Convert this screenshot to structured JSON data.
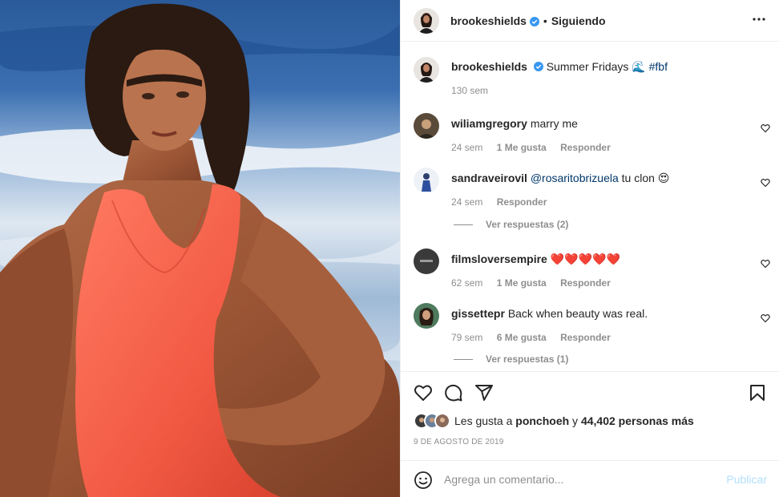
{
  "post": {
    "author": "brookeshields",
    "follow_separator": "•",
    "follow_label": "Siguiendo",
    "caption_text": "Summer Fridays 🌊 ",
    "caption_hashtag": "#fbf",
    "caption_time": "130 sem"
  },
  "comments": [
    {
      "user": "wiliamgregory",
      "text": "marry me",
      "time": "24 sem",
      "likes": "1 Me gusta",
      "reply": "Responder"
    },
    {
      "user": "sandraveirovil",
      "mention": "@rosaritobrizuela",
      "text": " tu clon 😍",
      "time": "24 sem",
      "reply": "Responder",
      "view_replies": "Ver respuestas (2)"
    },
    {
      "user": "filmsloversempire",
      "text": "❤️❤️❤️❤️❤️",
      "time": "62 sem",
      "likes": "1 Me gusta",
      "reply": "Responder"
    },
    {
      "user": "gissettepr",
      "text": "Back when beauty was real.",
      "time": "79 sem",
      "likes": "6 Me gusta",
      "reply": "Responder",
      "view_replies": "Ver respuestas (1)"
    }
  ],
  "likes": {
    "prefix": "Les gusta a ",
    "user": "ponchoeh",
    "conj": " y ",
    "count": "44,402 personas más"
  },
  "date": "9 DE AGOSTO DE 2019",
  "add_comment": {
    "placeholder": "Agrega un comentario...",
    "publish_label": "Publicar"
  },
  "colors": {
    "link": "#00376b",
    "muted": "#8e8e8e",
    "publish_disabled": "#b2dffc",
    "verified": "#3897f0"
  },
  "icons": [
    "more-options-icon",
    "heart-icon",
    "comment-icon",
    "share-icon",
    "bookmark-icon",
    "emoji-icon",
    "verified-badge-icon"
  ]
}
